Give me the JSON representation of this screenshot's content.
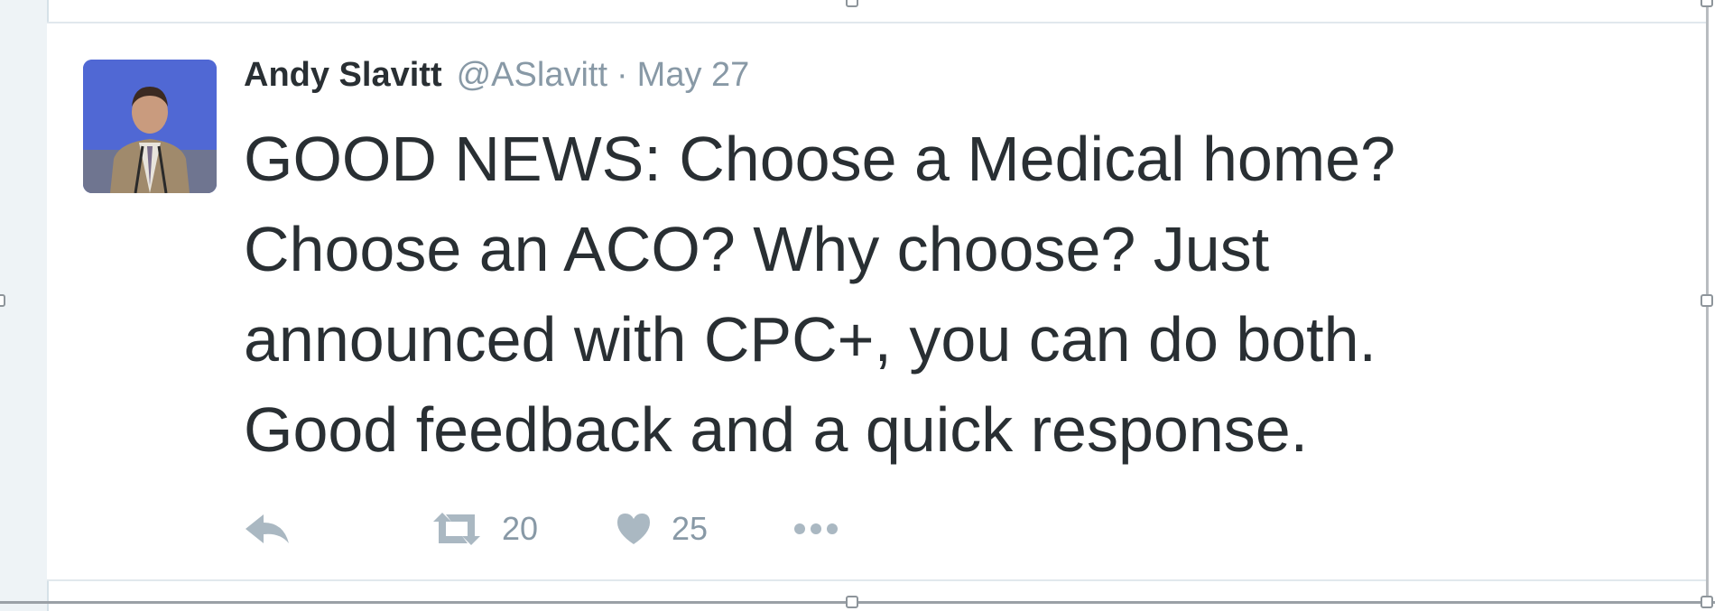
{
  "tweet": {
    "author_name": "Andy Slavitt",
    "author_handle": "@ASlavitt",
    "separator": "·",
    "date": "May 27",
    "text_lines": [
      "GOOD NEWS: Choose a Medical home?",
      "Choose an ACO? Why choose? Just",
      "announced with CPC+, you can do both.",
      "Good feedback and a quick response."
    ],
    "retweet_count": "20",
    "like_count": "25",
    "icons": {
      "reply": "reply-icon",
      "retweet": "retweet-icon",
      "like": "heart-icon",
      "more": "more-dots-icon"
    },
    "colors": {
      "text": "#292f33",
      "meta": "#8899a6",
      "icon": "#aab8c2"
    }
  }
}
